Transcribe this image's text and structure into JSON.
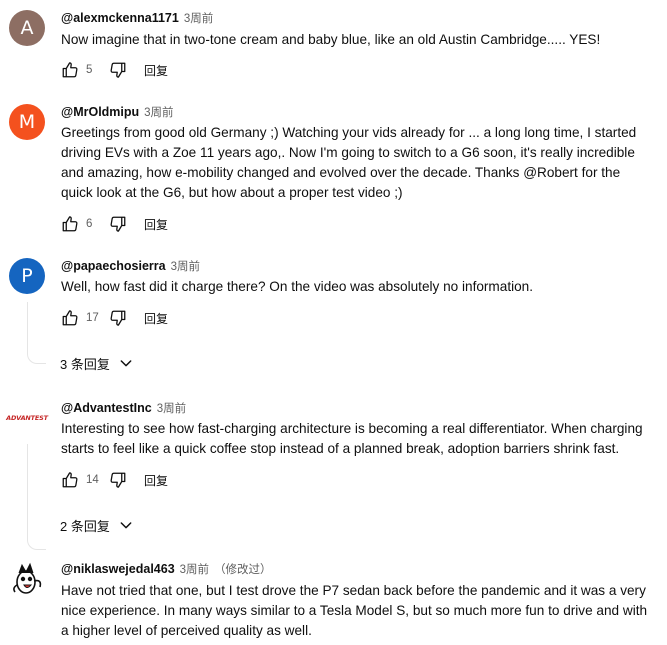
{
  "comments": [
    {
      "author": "@alexmckenna1171",
      "time": "3周前",
      "text": "Now imagine that in two-tone cream and baby blue, like an old Austin Cambridge..... YES!",
      "avatar_letter": "A",
      "avatar_color": "#8d6e63",
      "likes": "5",
      "reply_label": "回复"
    },
    {
      "author": "@MrOldmipu",
      "time": "3周前",
      "text": "Greetings from good old Germany ;) Watching your vids already for ... a long long time, I started\ndriving EVs with a Zoe 11 years ago,. Now I'm going to switch to a G6 soon, it's really incredible\nand amazing, how e-mobility changed and evolved over the decade. Thanks @Robert for the\nquick look at the G6, but how about a proper test video ;)",
      "avatar_letter": "M",
      "avatar_color": "#f4511e",
      "likes": "6",
      "reply_label": "回复"
    },
    {
      "author": "@papaechosierra",
      "time": "3周前",
      "text": "Well, how fast did it charge there? On the video was absolutely no information.",
      "avatar_letter": "P",
      "avatar_color": "#1565c0",
      "likes": "17",
      "reply_label": "回复",
      "replies_label": "3 条回复"
    },
    {
      "author": "@AdvantestInc",
      "time": "3周前",
      "text": "Interesting to see how fast-charging architecture is becoming a real differentiator. When charging\nstarts to feel like a quick coffee stop instead of a planned break, adoption barriers shrink fast.",
      "avatar_logo_text": "ADVANTEST",
      "avatar_logo_color": "#c62828",
      "likes": "14",
      "reply_label": "回复",
      "replies_label": "2 条回复"
    },
    {
      "author": "@niklaswejedal463",
      "time": "3周前",
      "edited": "（修改过）",
      "text": "Have not tried that one, but I test drove the P7 sedan back before the pandemic and it was a very\nnice experience. In many ways similar to a Tesla Model S, but so much more fun to drive and with\na higher level of perceived quality as well."
    }
  ],
  "icons": {
    "like": "thumb-up-icon",
    "dislike": "thumb-down-icon",
    "expand": "chevron-down-icon"
  }
}
